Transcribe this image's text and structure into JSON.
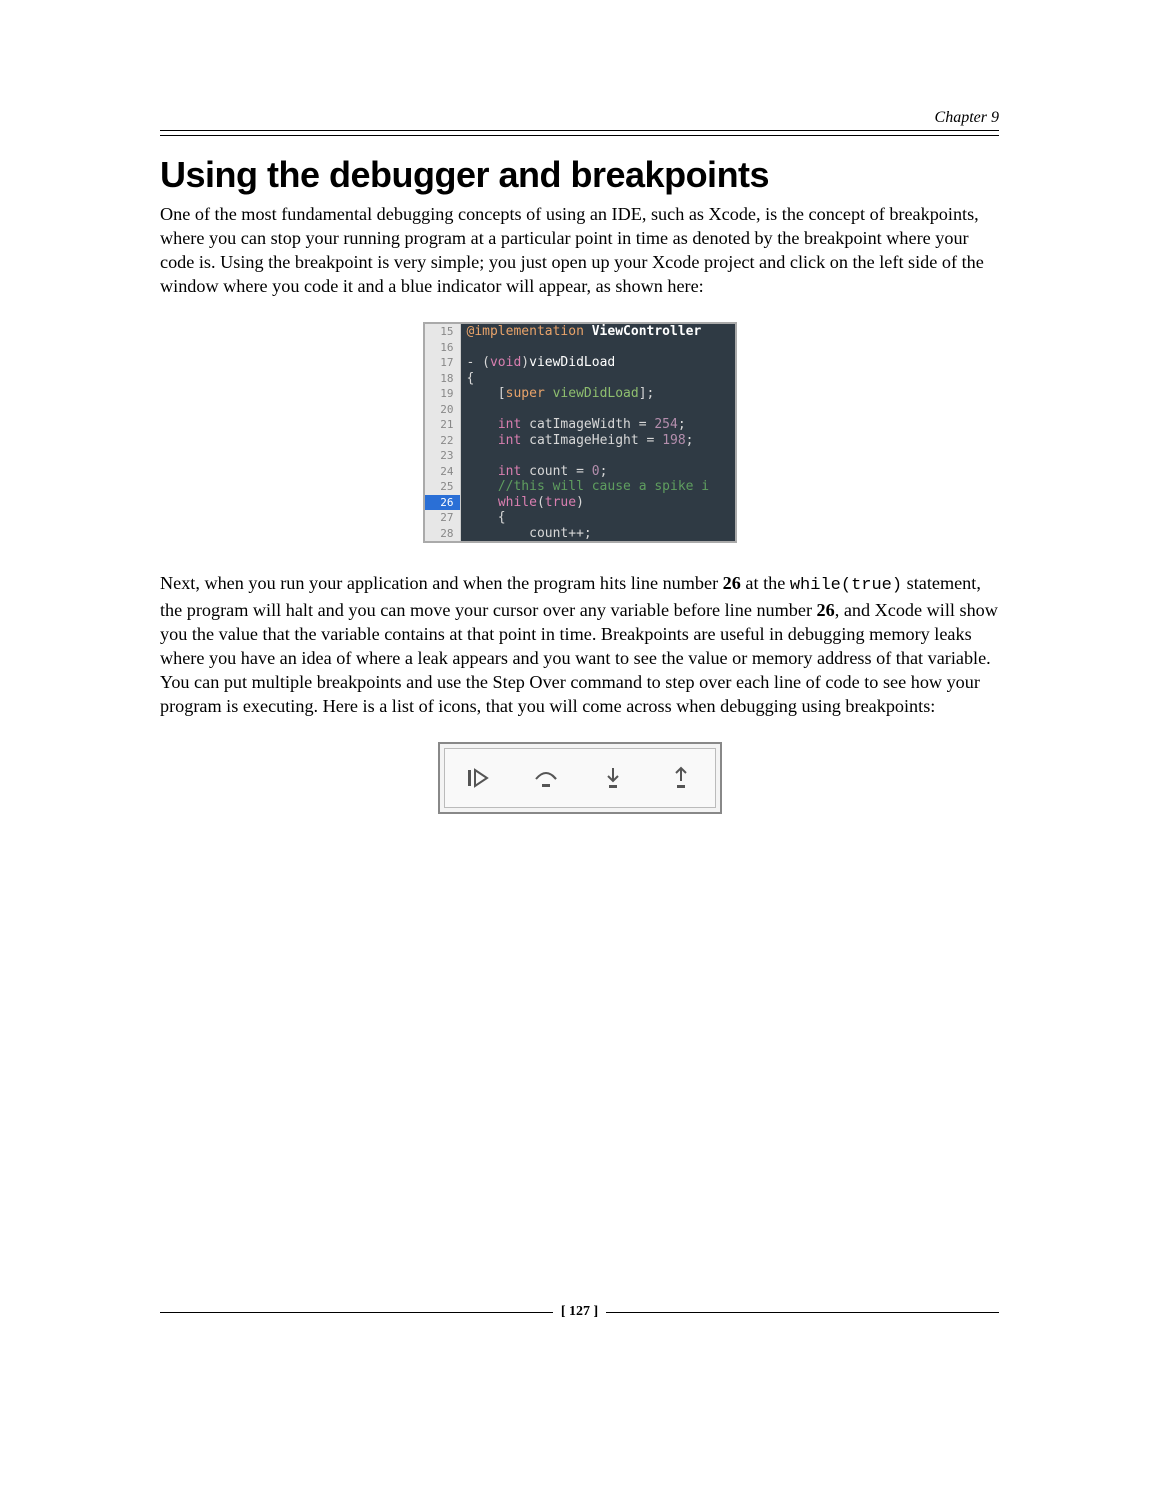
{
  "chapter_label": "Chapter 9",
  "title": "Using the debugger and breakpoints",
  "para1": "One of the most fundamental debugging concepts of using an IDE, such as Xcode, is the concept of breakpoints, where you can stop your running program at a particular point in time as denoted by the breakpoint where your code is. Using the breakpoint is very simple; you just open up your Xcode project and click on the left side of the window where you code it and a blue indicator will appear, as shown here:",
  "code_lines": [
    {
      "n": "15",
      "bp": false,
      "tokens": [
        {
          "t": "@implementation",
          "c": "kw-peach"
        },
        {
          "t": " ",
          "c": ""
        },
        {
          "t": "ViewController",
          "c": "cls"
        }
      ]
    },
    {
      "n": "16",
      "bp": false,
      "tokens": []
    },
    {
      "n": "17",
      "bp": false,
      "tokens": [
        {
          "t": "- (",
          "c": ""
        },
        {
          "t": "void",
          "c": "kw-pink"
        },
        {
          "t": ")",
          "c": ""
        },
        {
          "t": "viewDidLoad",
          "c": "method"
        }
      ]
    },
    {
      "n": "18",
      "bp": false,
      "tokens": [
        {
          "t": "{",
          "c": ""
        }
      ]
    },
    {
      "n": "19",
      "bp": false,
      "tokens": [
        {
          "t": "    [",
          "c": ""
        },
        {
          "t": "super",
          "c": "kw-peach"
        },
        {
          "t": " ",
          "c": ""
        },
        {
          "t": "viewDidLoad",
          "c": "msg"
        },
        {
          "t": "];",
          "c": ""
        }
      ]
    },
    {
      "n": "20",
      "bp": false,
      "tokens": []
    },
    {
      "n": "21",
      "bp": false,
      "tokens": [
        {
          "t": "    ",
          "c": ""
        },
        {
          "t": "int",
          "c": "kw-pink"
        },
        {
          "t": " catImageWidth = ",
          "c": ""
        },
        {
          "t": "254",
          "c": "num"
        },
        {
          "t": ";",
          "c": ""
        }
      ]
    },
    {
      "n": "22",
      "bp": false,
      "tokens": [
        {
          "t": "    ",
          "c": ""
        },
        {
          "t": "int",
          "c": "kw-pink"
        },
        {
          "t": " catImageHeight = ",
          "c": ""
        },
        {
          "t": "198",
          "c": "num"
        },
        {
          "t": ";",
          "c": ""
        }
      ]
    },
    {
      "n": "23",
      "bp": false,
      "tokens": []
    },
    {
      "n": "24",
      "bp": false,
      "tokens": [
        {
          "t": "    ",
          "c": ""
        },
        {
          "t": "int",
          "c": "kw-pink"
        },
        {
          "t": " count = ",
          "c": ""
        },
        {
          "t": "0",
          "c": "num"
        },
        {
          "t": ";",
          "c": ""
        }
      ]
    },
    {
      "n": "25",
      "bp": false,
      "tokens": [
        {
          "t": "    ",
          "c": ""
        },
        {
          "t": "//this will cause a spike i",
          "c": "cmt"
        }
      ]
    },
    {
      "n": "26",
      "bp": true,
      "tokens": [
        {
          "t": "    ",
          "c": ""
        },
        {
          "t": "while",
          "c": "kw-pink"
        },
        {
          "t": "(",
          "c": ""
        },
        {
          "t": "true",
          "c": "kw-pink"
        },
        {
          "t": ")",
          "c": ""
        }
      ]
    },
    {
      "n": "27",
      "bp": false,
      "tokens": [
        {
          "t": "    {",
          "c": ""
        }
      ]
    },
    {
      "n": "28",
      "bp": false,
      "tokens": [
        {
          "t": "        count++;",
          "c": ""
        }
      ]
    }
  ],
  "para2_parts": {
    "a": "Next, when you run your application and when the program hits line number ",
    "b": "26",
    "c": " at the ",
    "d": "while(true)",
    "e": " statement, the program will halt and you can move your cursor over any variable before line number ",
    "f": "26",
    "g": ", and Xcode will show you the value that the variable contains at that point in time. Breakpoints are useful in debugging memory leaks where you have an idea of where a leak appears and you want to see the value or memory address of that variable. You can put multiple breakpoints and use the Step Over command to step over each line of code to see how your program is executing. Here is a list of icons, that you will come across when debugging using breakpoints:"
  },
  "debug_icons": [
    "continue-icon",
    "step-over-icon",
    "step-into-icon",
    "step-out-icon"
  ],
  "page_number": "[ 127 ]"
}
